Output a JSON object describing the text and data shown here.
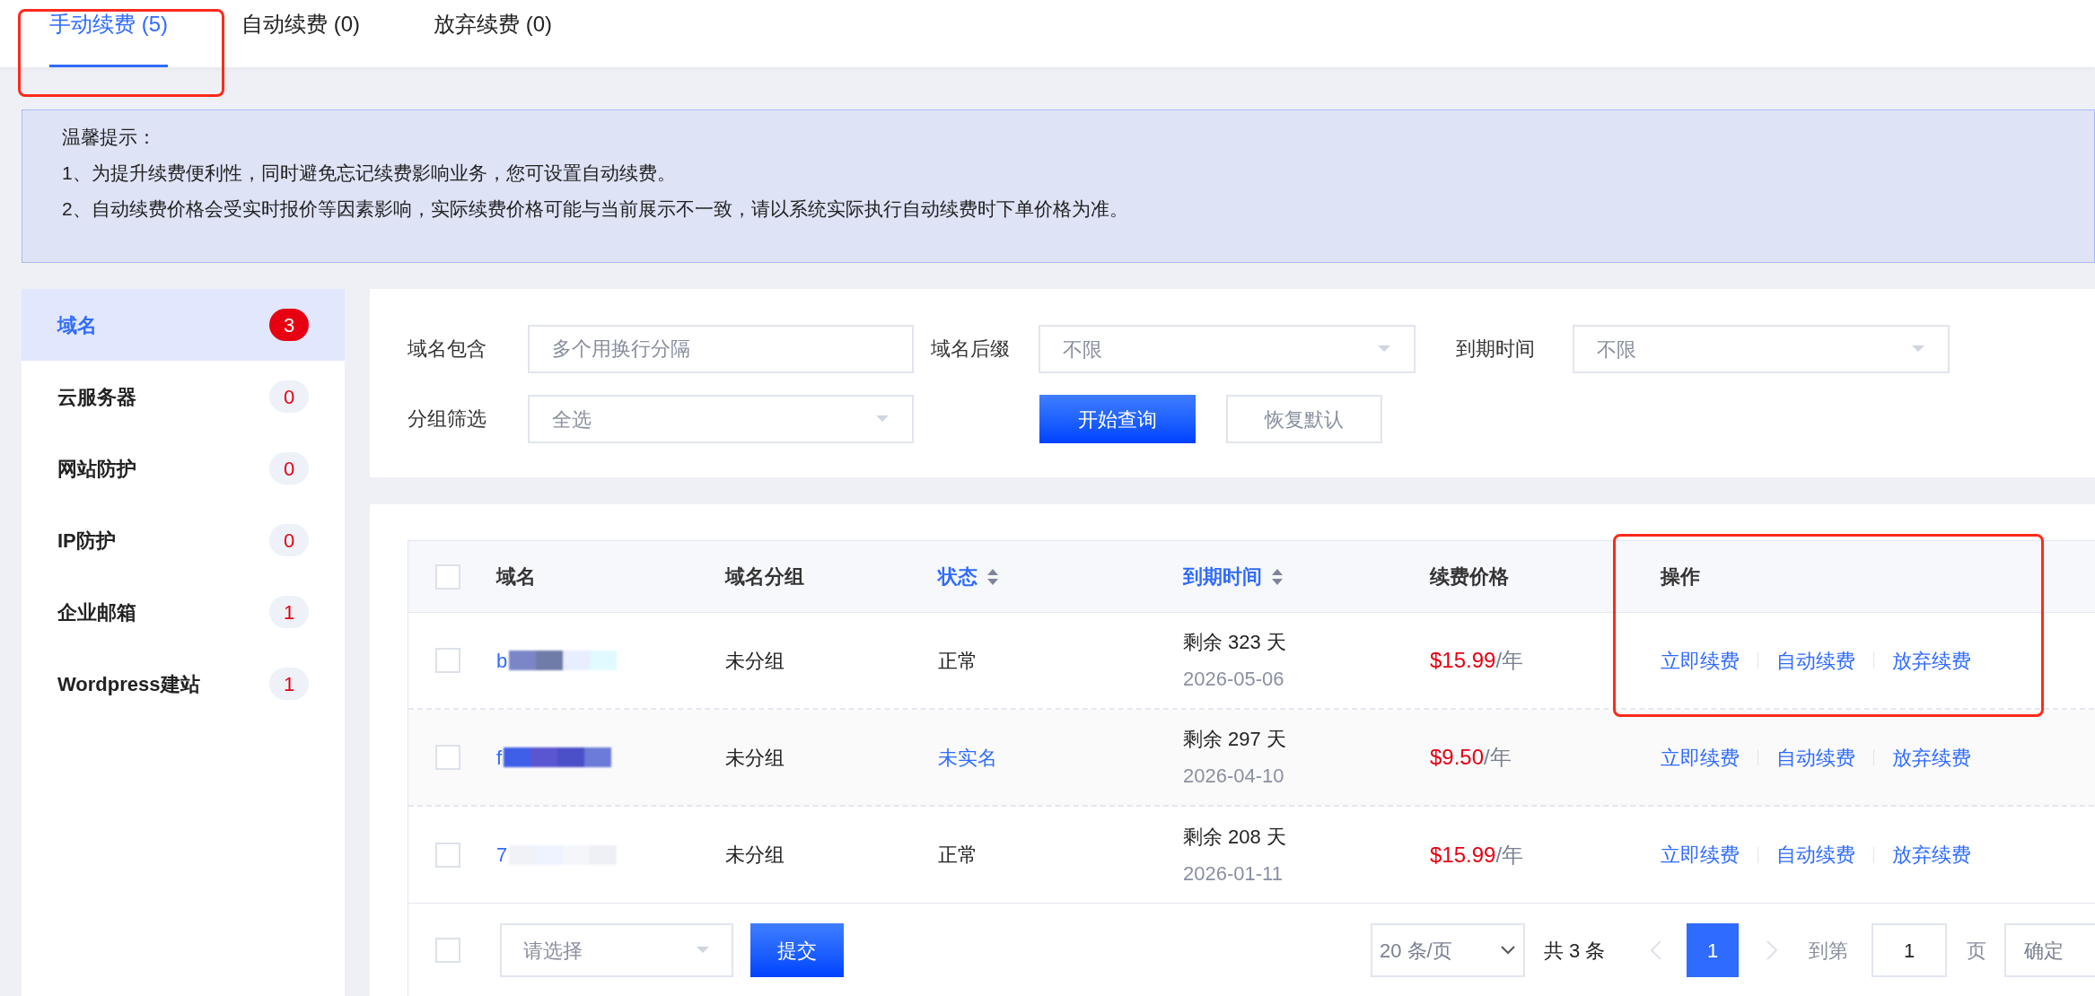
{
  "tabs": [
    {
      "label": "手动续费 (5)",
      "selected": true
    },
    {
      "label": "自动续费 (0)",
      "selected": false
    },
    {
      "label": "放弃续费 (0)",
      "selected": false
    }
  ],
  "notice": {
    "title": "温馨提示：",
    "lines": [
      "1、为提升续费便利性，同时避免忘记续费影响业务，您可设置自动续费。",
      "2、自动续费价格会受实时报价等因素影响，实际续费价格可能与当前展示不一致，请以系统实际执行自动续费时下单价格为准。"
    ]
  },
  "sidebar": {
    "items": [
      {
        "label": "域名",
        "count": "3",
        "selected": true
      },
      {
        "label": "云服务器",
        "count": "0",
        "selected": false
      },
      {
        "label": "网站防护",
        "count": "0",
        "selected": false
      },
      {
        "label": "IP防护",
        "count": "0",
        "selected": false
      },
      {
        "label": "企业邮箱",
        "count": "1",
        "selected": false
      },
      {
        "label": "Wordpress建站",
        "count": "1",
        "selected": false
      }
    ]
  },
  "filters": {
    "fields": [
      {
        "label": "域名包含",
        "kind": "text",
        "placeholder": "多个用换行分隔"
      },
      {
        "label": "域名后缀",
        "kind": "select",
        "value": "不限"
      },
      {
        "label": "到期时间",
        "kind": "select",
        "value": "不限"
      },
      {
        "label": "分组筛选",
        "kind": "select",
        "value": "全选"
      }
    ],
    "search_button": "开始查询",
    "reset_button": "恢复默认"
  },
  "table": {
    "columns": [
      {
        "label": "域名",
        "sortable": false
      },
      {
        "label": "域名分组",
        "sortable": false
      },
      {
        "label": "状态",
        "sortable": true
      },
      {
        "label": "到期时间",
        "sortable": true
      },
      {
        "label": "续费价格",
        "sortable": false
      },
      {
        "label": "操作",
        "sortable": false
      }
    ],
    "rows": [
      {
        "checked": false,
        "domain": "b",
        "group": "未分组",
        "status": "正常",
        "status_link": false,
        "remaining": "剩余 323 天",
        "date": "2026-05-06",
        "price": "$15.99",
        "unit": "/年",
        "actions": [
          "立即续费",
          "自动续费",
          "放弃续费"
        ]
      },
      {
        "checked": false,
        "domain": "f",
        "group": "未分组",
        "status": "未实名",
        "status_link": true,
        "remaining": "剩余 297 天",
        "date": "2026-04-10",
        "price": "$9.50",
        "unit": "/年",
        "actions": [
          "立即续费",
          "自动续费",
          "放弃续费"
        ]
      },
      {
        "checked": false,
        "domain": "7",
        "group": "未分组",
        "status": "正常",
        "status_link": false,
        "remaining": "剩余 208 天",
        "date": "2026-01-11",
        "price": "$15.99",
        "unit": "/年",
        "actions": [
          "立即续费",
          "自动续费",
          "放弃续费"
        ]
      }
    ]
  },
  "footer": {
    "select_all_checked": false,
    "batch_checked": false,
    "batch_placeholder": "请选择",
    "submit": "提交",
    "page_size": "20 条/页",
    "total": "共 3 条",
    "pages": [
      {
        "label": "1",
        "selected": true
      }
    ],
    "goto_label": "到第",
    "goto_value": "1",
    "page_unit": "页",
    "confirm": "确定"
  }
}
